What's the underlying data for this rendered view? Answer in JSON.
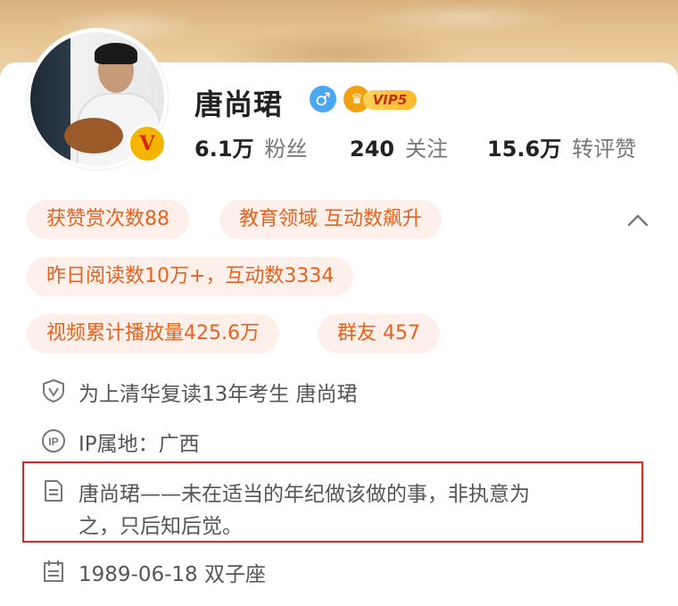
{
  "profile": {
    "name": "唐尚珺",
    "vip_level": "VIP5",
    "avatar_badge": "V"
  },
  "stats": [
    {
      "value": "6.1万",
      "label": "粉丝"
    },
    {
      "value": "240",
      "label": "关注"
    },
    {
      "value": "15.6万",
      "label": "转评赞"
    }
  ],
  "tags": [
    "获赞赏次数88",
    "教育领域 互动数飙升",
    "昨日阅读数10万+，互动数3334",
    "视频累计播放量425.6万",
    "群友 457"
  ],
  "info": {
    "verified": "为上清华复读13年考生 唐尚珺",
    "ip": "IP属地：广西",
    "bio_line1": "唐尚珺——未在适当的年纪做该做的事，非执意为",
    "bio_line2": "之，只后知后觉。",
    "birthday": "1989-06-18 双子座"
  },
  "icons": {
    "gender": "male-icon",
    "vip": "vip-crown-icon",
    "collapse": "chevron-up-icon",
    "verified": "shield-v-icon",
    "ip": "ip-icon",
    "bio": "document-icon",
    "birthday": "calendar-icon"
  },
  "colors": {
    "tag_bg": "#fdf0ea",
    "tag_text": "#e8611f",
    "gender_blue": "#4aa7f2",
    "highlight_red": "#e8231f"
  }
}
